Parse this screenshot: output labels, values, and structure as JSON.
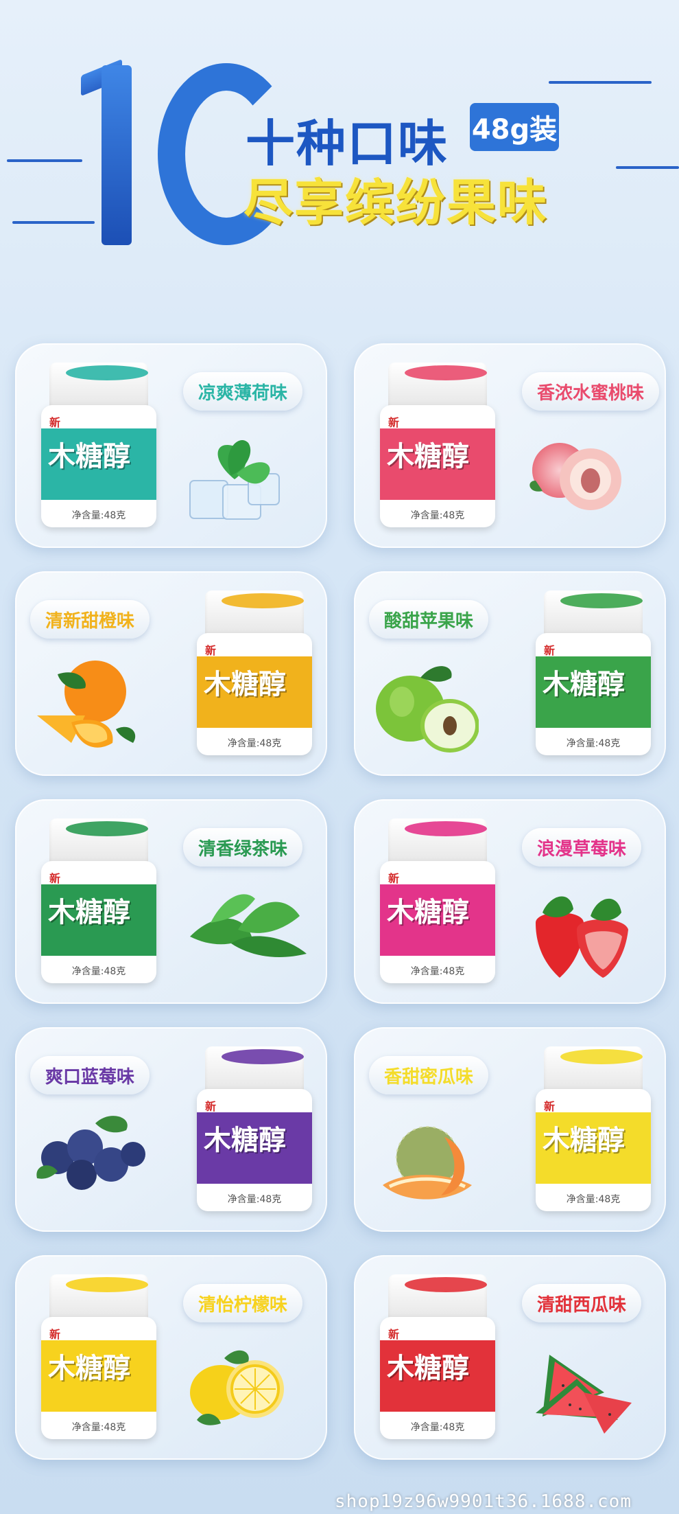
{
  "header": {
    "big_number": "10",
    "title_main": "十种口味",
    "size_tag": "48g装",
    "title_sub": "尽享缤纷果味"
  },
  "product": {
    "brand": "木糖醇",
    "new_label": "新",
    "net_weight": "净含量:48克"
  },
  "flavors": [
    {
      "label": "凉爽薄荷味",
      "color": "#2bb5a6",
      "fruit": "mint-icon"
    },
    {
      "label": "香浓水蜜桃味",
      "color": "#e94b6d",
      "fruit": "peach-icon"
    },
    {
      "label": "清新甜橙味",
      "color": "#f1b21c",
      "fruit": "orange-icon"
    },
    {
      "label": "酸甜苹果味",
      "color": "#3aa44a",
      "fruit": "green-apple-icon"
    },
    {
      "label": "清香绿茶味",
      "color": "#2a9a52",
      "fruit": "tea-leaf-icon"
    },
    {
      "label": "浪漫草莓味",
      "color": "#e3348a",
      "fruit": "strawberry-icon"
    },
    {
      "label": "爽口蓝莓味",
      "color": "#6a3aa6",
      "fruit": "blueberry-icon"
    },
    {
      "label": "香甜密瓜味",
      "color": "#f4dc2a",
      "fruit": "melon-icon"
    },
    {
      "label": "清怡柠檬味",
      "color": "#f7d21e",
      "fruit": "lemon-icon"
    },
    {
      "label": "清甜西瓜味",
      "color": "#e2323a",
      "fruit": "watermelon-icon"
    }
  ],
  "watermark": "shop19z96w9901t36.1688.com"
}
